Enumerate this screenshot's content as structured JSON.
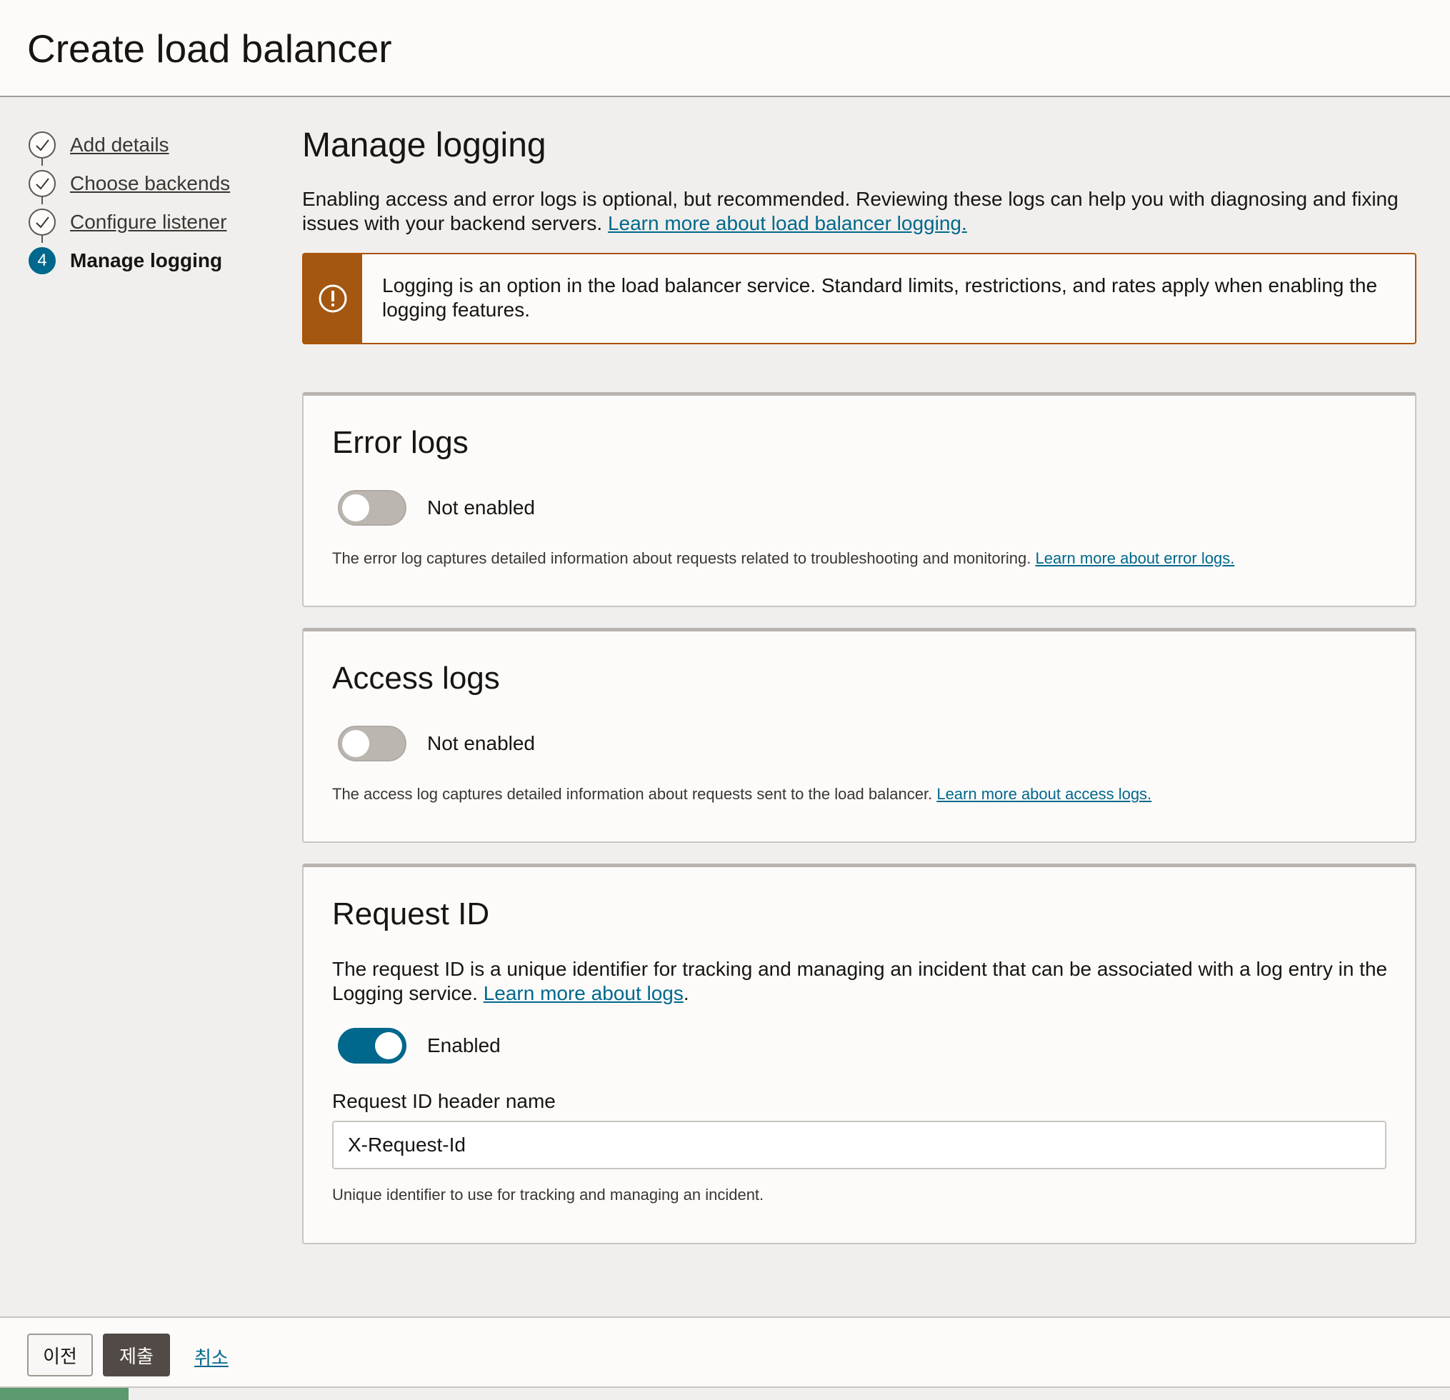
{
  "page": {
    "title": "Create load balancer"
  },
  "steps": [
    {
      "number": "",
      "label": "Add details",
      "state": "complete"
    },
    {
      "number": "",
      "label": "Choose backends",
      "state": "complete"
    },
    {
      "number": "",
      "label": "Configure listener",
      "state": "complete"
    },
    {
      "number": "4",
      "label": "Manage logging",
      "state": "current"
    }
  ],
  "main": {
    "heading": "Manage logging",
    "intro": "Enabling access and error logs is optional, but recommended. Reviewing these logs can help you with diagnosing and fixing issues with your backend servers.",
    "intro_link": "Learn more about load balancer logging.",
    "alert": {
      "icon": "warning-circle-icon",
      "text": "Logging is an option in the load balancer service. Standard limits, restrictions, and rates apply when enabling the logging features."
    }
  },
  "error_logs": {
    "heading": "Error logs",
    "toggle_state": "Not enabled",
    "enabled": false,
    "help": "The error log captures detailed information about requests related to troubleshooting and monitoring.",
    "help_link": "Learn more about error logs."
  },
  "access_logs": {
    "heading": "Access logs",
    "toggle_state": "Not enabled",
    "enabled": false,
    "help": "The access log captures detailed information about requests sent to the load balancer.",
    "help_link": "Learn more about access logs."
  },
  "request_id": {
    "heading": "Request ID",
    "description": "The request ID is a unique identifier for tracking and managing an incident that can be associated with a log entry in the Logging service.",
    "description_link": "Learn more about logs",
    "description_end": ".",
    "toggle_state": "Enabled",
    "enabled": true,
    "field_label": "Request ID header name",
    "field_value": "X-Request-Id",
    "field_help": "Unique identifier to use for tracking and managing an incident."
  },
  "footer": {
    "prev_label": "이전",
    "submit_label": "제출",
    "cancel_label": "취소"
  },
  "colors": {
    "accent": "#00688c",
    "warning": "#a35710",
    "progress": "#5a9a6e"
  }
}
